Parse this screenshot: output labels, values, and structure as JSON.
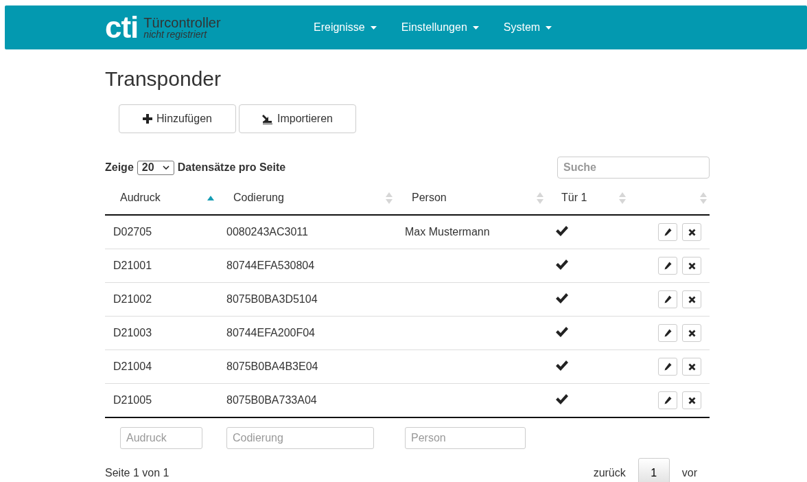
{
  "navbar": {
    "logo": "cti",
    "title": "Türcontroller",
    "subtitle": "nicht registriert",
    "menus": [
      {
        "label": "Ereignisse"
      },
      {
        "label": "Einstellungen"
      },
      {
        "label": "System"
      }
    ]
  },
  "page_title": "Transponder",
  "actions": [
    {
      "kind": "add",
      "label": "Hinzufügen"
    },
    {
      "kind": "import",
      "label": "Importieren"
    }
  ],
  "length_menu": {
    "prefix": "Zeige",
    "value": "20",
    "suffix": "Datensätze pro Seite"
  },
  "search": {
    "placeholder": "Suche"
  },
  "table": {
    "columns": [
      {
        "label": "Audruck",
        "sorted": true
      },
      {
        "label": "Codierung",
        "sorted": false
      },
      {
        "label": "Person",
        "sorted": false
      },
      {
        "label": "Tür 1",
        "sorted": false
      },
      {
        "sorted": false
      }
    ],
    "rows": [
      {
        "audruck": "D02705",
        "codierung": "0080243AC3011",
        "person": "Max Mustermann",
        "door_1": true
      },
      {
        "audruck": "D21001",
        "codierung": "80744EFA530804",
        "door_1": true
      },
      {
        "audruck": "D21002",
        "codierung": "8075B0BA3D5104",
        "door_1": true
      },
      {
        "audruck": "D21003",
        "codierung": "80744EFA200F04",
        "door_1": true
      },
      {
        "audruck": "D21004",
        "codierung": "8075B0BA4B3E04",
        "door_1": true
      },
      {
        "audruck": "D21005",
        "codierung": "8075B0BA733A04",
        "door_1": true
      }
    ],
    "filters": [
      {
        "placeholder": "Audruck"
      },
      {
        "placeholder": "Codierung"
      },
      {
        "placeholder": "Person"
      }
    ]
  },
  "info": "Seite 1 von 1",
  "pagination": {
    "previous": "zurück",
    "pages": [
      {
        "label": "1",
        "selected": true
      }
    ],
    "next": "vor"
  }
}
